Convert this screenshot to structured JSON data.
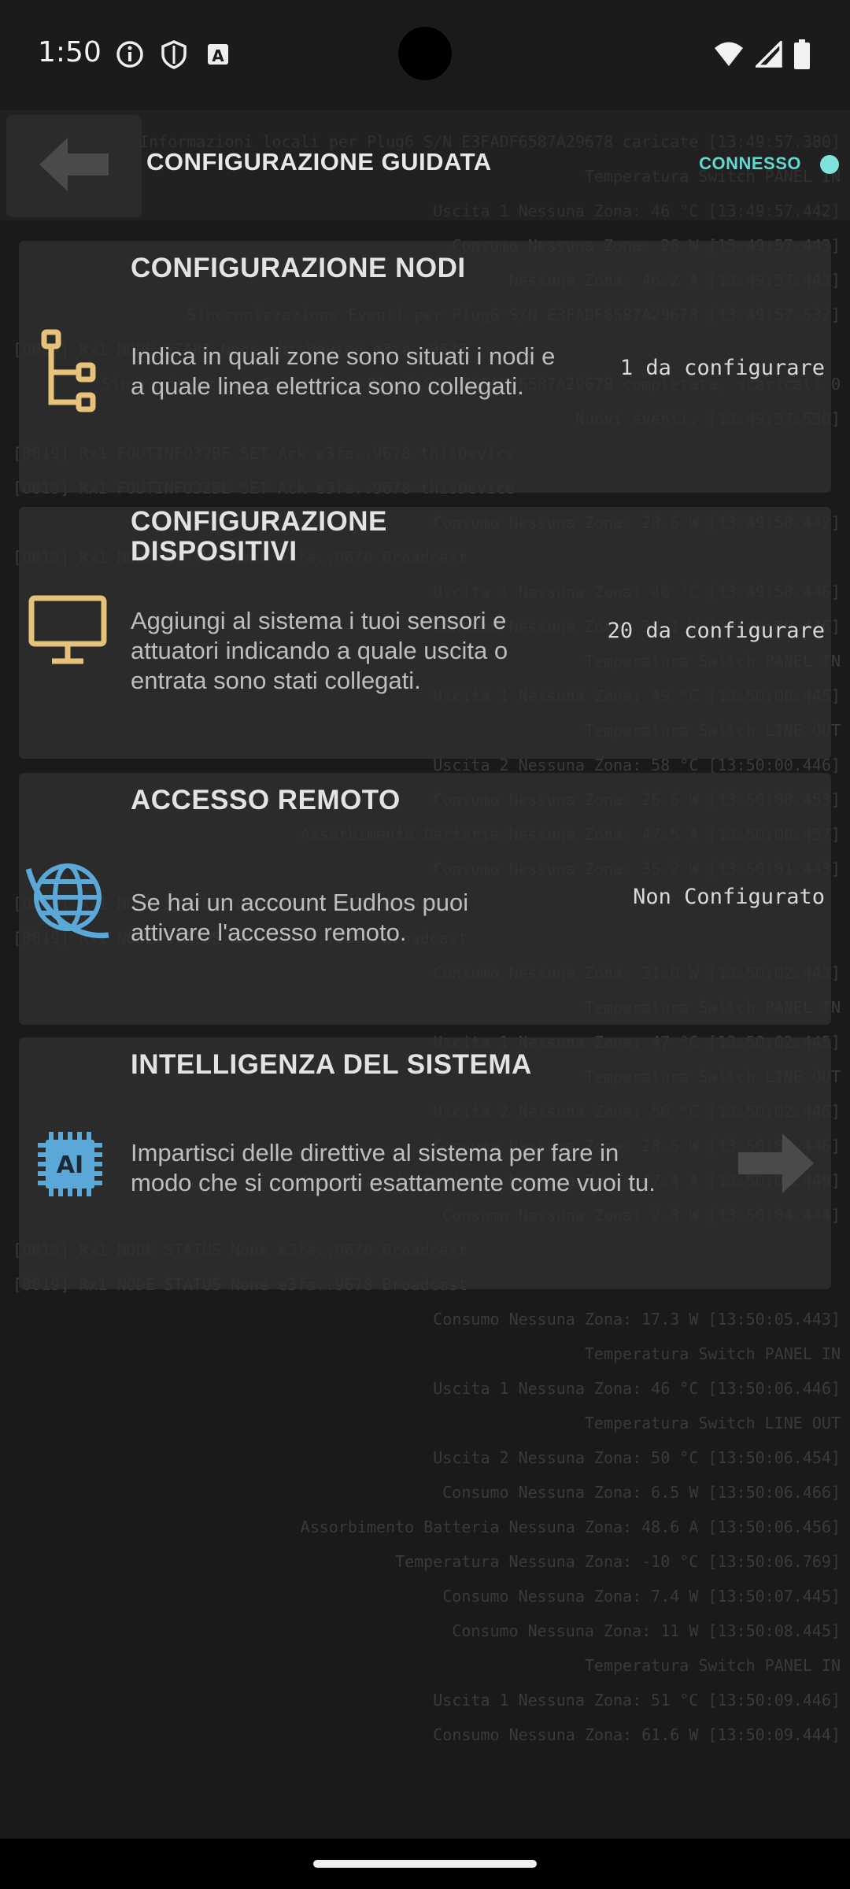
{
  "status_bar": {
    "time": "1:50",
    "left_icons": [
      "info-icon",
      "shield-icon",
      "text-icon"
    ],
    "right_icons": [
      "wifi-icon",
      "signal-icon",
      "battery-icon"
    ]
  },
  "header": {
    "title": "CONFIGURAZIONE GUIDATA",
    "connection_status": "CONNESSO",
    "connection_color": "#7fe3db"
  },
  "cards": [
    {
      "title": "CONFIGURAZIONE NODI",
      "description": "Indica in quali zone sono situati i nodi e a quale linea elettrica sono collegati.",
      "status": "1 da configurare",
      "icon": "node-tree-icon",
      "icon_color": "#e6c27a"
    },
    {
      "title": "CONFIGURAZIONE DISPOSITIVI",
      "description": "Aggiungi al sistema i tuoi sensori e attuatori indicando a quale uscita o entrata sono stati collegati.",
      "status": "20 da configurare",
      "icon": "monitor-icon",
      "icon_color": "#e6c27a"
    },
    {
      "title": "ACCESSO REMOTO",
      "description": "Se hai un account Eudhos puoi attivare l'accesso remoto.",
      "status": "Non Configurato",
      "icon": "globe-icon",
      "icon_color": "#5aa8d8"
    },
    {
      "title": "INTELLIGENZA DEL SISTEMA",
      "description": "Impartisci delle direttive al sistema per fare in modo che si comporti esattamente come vuoi tu.",
      "status": "",
      "icon": "ai-chip-icon",
      "icon_label": "AI",
      "icon_color": "#5aa8d8"
    }
  ],
  "log_lines": [
    "Informazioni locali per Plug6 S/N E3FADF6587A29678 caricate [13:49:57.380]",
    "Temperatura Switch PANEL IN",
    "Uscita 1 Nessuna Zona: 46 °C [13:49:57.442]",
    "Consumo Nessuna Zona: 26 W [13:49:57.443]",
    "Nessuna Zona: 46.2 A [13:49:57.443]",
    "Sincronizzazione Eventi per Plug6 S/N E3FADF6587A29678 [13:49:57.532]",
    "[0019] Rx1 NODE          START         None     thisDevice      e3fa..9678",
    "Sincronizzazione Eventi per Plug6 S/N E3FADF6587A29678 completata, scaricati 0",
    "Nuovi eventi. [13:49:57.550]",
    "[0019] Rx1 FOUTINFO32BE  SET           Ack      e3fa..9678      thisDevice",
    "[0019] Rx1 FOUTINFO32BE  SET           Ack      e3fa..9678      thisDevice",
    "Consumo Nessuna Zona: 20.6 W [13:49:58.442]",
    "[0019] Rx1 NODE          STATUS        None     e3fa..9678      Broadcast",
    "Uscita 1 Nessuna Zona: 46 °C [13:49:58.446]",
    "Consumo Nessuna Zona: 30.1 W [13:49:59.446]",
    "Temperatura Switch PANEL IN",
    "Uscita 1 Nessuna Zona: 49 °C [13:50:00.445]",
    "Temperatura Switch LINE OUT",
    "Uscita 2 Nessuna Zona: 58 °C [13:50:00.446]",
    "Consumo Nessuna Zona: 26.6 W [13:50:00.453]",
    "Assorbimento Batteria Nessuna Zona: 47.5 A [13:50:00.457]",
    "Consumo Nessuna Zona: 35.2 W [13:50:01.443]",
    "[0019] Rx1 NODE          STATUS        None     e3fa..9678      Broadcast",
    "[0019] Rx1 NODE          STATUS        None     e3fa..9678      Broadcast",
    "Consumo Nessuna Zona: 31.0 W [13:50:02.443]",
    "Temperatura Switch PANEL IN",
    "Uscita 1 Nessuna Zona: 47 °C [13:50:02.445]",
    "Temperatura Switch LINE OUT",
    "Uscita 2 Nessuna Zona: 56 °C [13:50:02.446]",
    "Consumo Nessuna Zona: 28.5 W [13:50:03.446]",
    "Assorbimento Batteria Nessuna Zona: 47.4 A [13:50:03.449]",
    "Consumo Nessuna Zona: 2.3 W [13:50:04.444]",
    "[0019] Rx1 NODE          STATUS        None     e3fa..9678      Broadcast",
    "[0019] Rx1 NODE          STATUS        None     e3fa..9678      Broadcast",
    "Consumo Nessuna Zona: 17.3 W [13:50:05.443]",
    "Temperatura Switch PANEL IN",
    "Uscita 1 Nessuna Zona: 46 °C [13:50:06.446]",
    "Temperatura Switch LINE OUT",
    "Uscita 2 Nessuna Zona: 50 °C [13:50:06.454]",
    "Consumo Nessuna Zona: 6.5 W [13:50:06.466]",
    "Assorbimento Batteria Nessuna Zona: 48.6 A [13:50:06.456]",
    "Temperatura Nessuna Zona: -10 °C [13:50:06.769]",
    "Consumo Nessuna Zona: 7.4 W [13:50:07.445]",
    "Consumo Nessuna Zona: 11 W [13:50:08.445]",
    "Temperatura Switch PANEL IN",
    "Uscita 1 Nessuna Zona: 51 °C [13:50:09.446]",
    "Consumo Nessuna Zona: 61.6 W [13:50:09.444]"
  ]
}
